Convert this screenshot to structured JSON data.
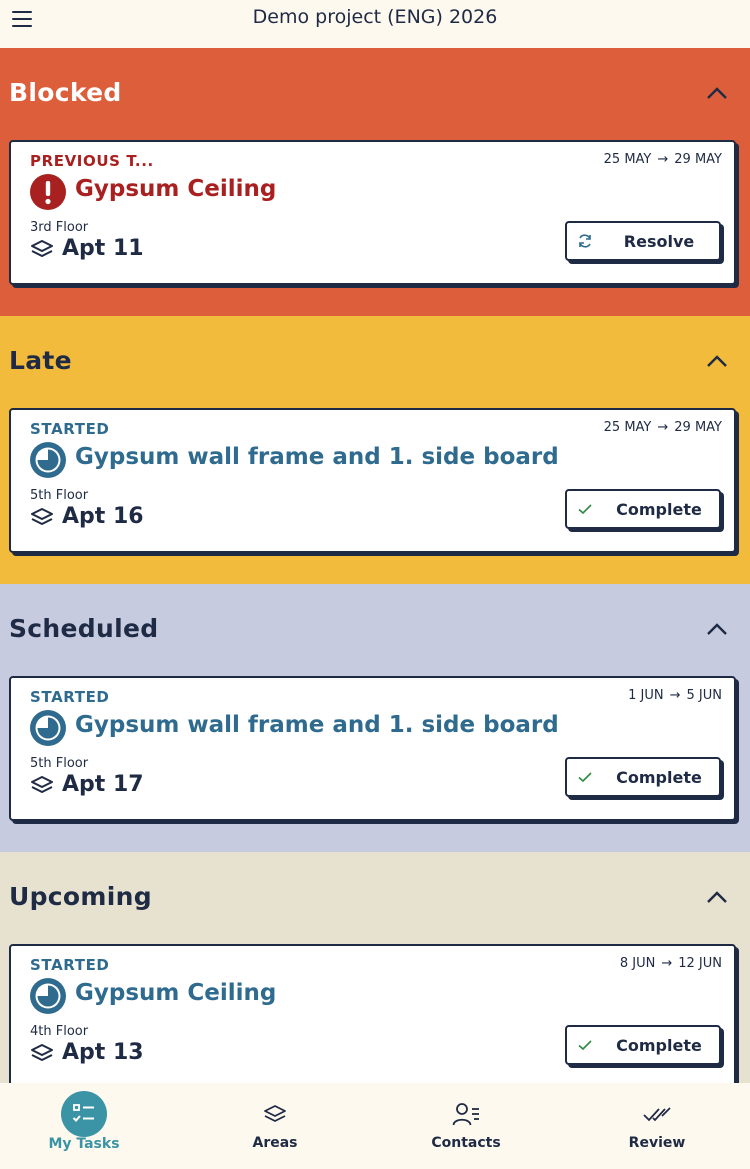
{
  "header": {
    "title": "Demo project (ENG) 2026",
    "menu_icon": "hamburger-menu-icon"
  },
  "colors": {
    "blocked_bg": "#dc5e3b",
    "late_bg": "#f2bb3b",
    "scheduled_bg": "#c6cbe0",
    "upcoming_bg": "#e6e2cf",
    "blocked_text": "#a8201f",
    "started_text": "#2f6a8f",
    "dark": "#1f2a44",
    "active_nav": "#3b94a6"
  },
  "sections": [
    {
      "title": "Blocked",
      "collapse_icon": "chevron-up-icon",
      "card": {
        "status": "PREVIOUS T...",
        "start_date": "25 MAY",
        "end_date": "29 MAY",
        "task_icon": "exclamation-circle-icon",
        "task": "Gypsum Ceiling",
        "floor": "3rd Floor",
        "apt": "Apt 11",
        "action": "Resolve",
        "action_icon": "refresh-icon"
      }
    },
    {
      "title": "Late",
      "collapse_icon": "chevron-up-icon",
      "card": {
        "status": "STARTED",
        "start_date": "25 MAY",
        "end_date": "29 MAY",
        "task_icon": "clock-progress-icon",
        "task": "Gypsum wall frame and 1. side board",
        "floor": "5th Floor",
        "apt": "Apt 16",
        "action": "Complete",
        "action_icon": "checkmark-icon"
      }
    },
    {
      "title": "Scheduled",
      "collapse_icon": "chevron-up-icon",
      "card": {
        "status": "STARTED",
        "start_date": "1 JUN",
        "end_date": "5 JUN",
        "task_icon": "clock-progress-icon",
        "task": "Gypsum wall frame and 1. side board",
        "floor": "5th Floor",
        "apt": "Apt 17",
        "action": "Complete",
        "action_icon": "checkmark-icon"
      }
    },
    {
      "title": "Upcoming",
      "collapse_icon": "chevron-up-icon",
      "card": {
        "status": "STARTED",
        "start_date": "8 JUN",
        "end_date": "12 JUN",
        "task_icon": "clock-progress-icon",
        "task": "Gypsum Ceiling",
        "floor": "4th Floor",
        "apt": "Apt 13",
        "action": "Complete",
        "action_icon": "checkmark-icon"
      }
    }
  ],
  "arrow_glyph": "→",
  "nav": [
    {
      "label": "My Tasks",
      "icon": "task-list-icon",
      "active": true
    },
    {
      "label": "Areas",
      "icon": "layers-icon",
      "active": false
    },
    {
      "label": "Contacts",
      "icon": "contacts-icon",
      "active": false
    },
    {
      "label": "Review",
      "icon": "double-check-icon",
      "active": false
    }
  ]
}
